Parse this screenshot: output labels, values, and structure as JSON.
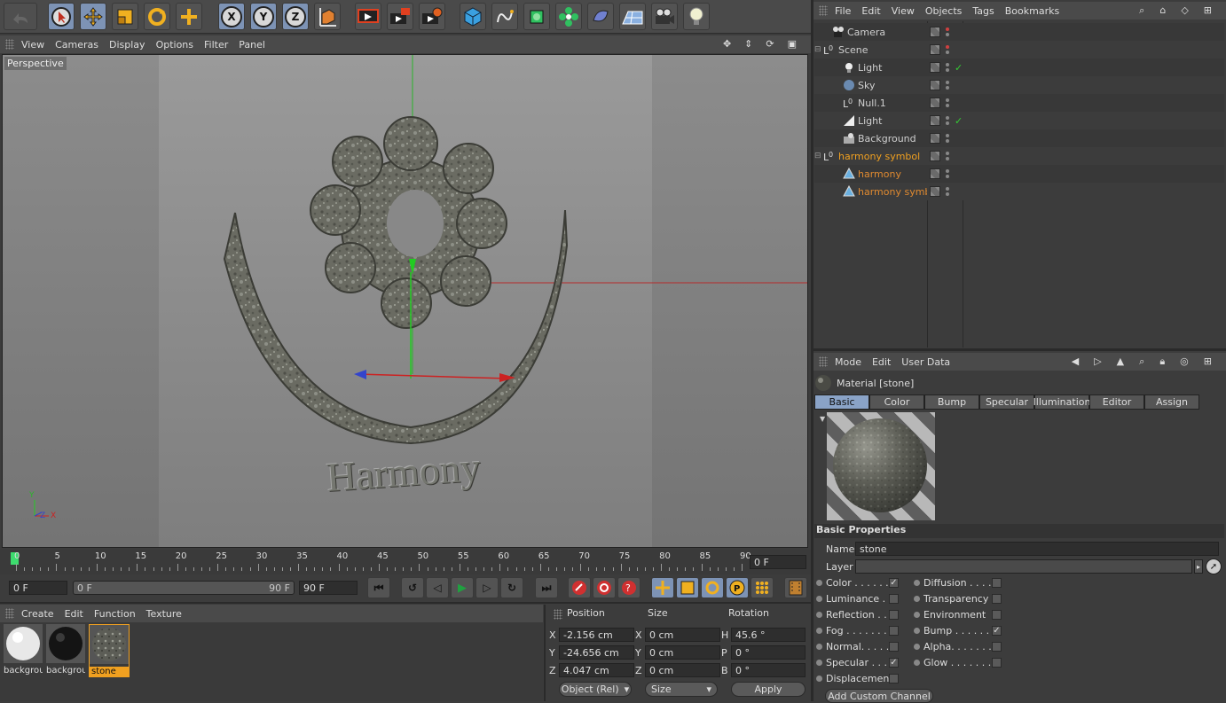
{
  "viewport_menu": [
    "View",
    "Cameras",
    "Display",
    "Options",
    "Filter",
    "Panel"
  ],
  "viewport_label": "Perspective",
  "viewport_text": "Harmony",
  "axis_labels": {
    "y": "Y",
    "z": "Z",
    "x": "X"
  },
  "toolbar": {
    "axis_x": "X",
    "axis_y": "Y",
    "axis_z": "Z"
  },
  "objects_menu": [
    "File",
    "Edit",
    "View",
    "Objects",
    "Tags",
    "Bookmarks"
  ],
  "objects": [
    {
      "name": "Camera",
      "indent": 1,
      "icon": "camera-icon",
      "color": "#cfcfcf"
    },
    {
      "name": "Scene",
      "indent": 0,
      "icon": "null-icon",
      "color": "#cfcfcf"
    },
    {
      "name": "Light",
      "indent": 2,
      "icon": "light-icon",
      "color": "#cfcfcf"
    },
    {
      "name": "Sky",
      "indent": 2,
      "icon": "sky-icon",
      "color": "#cfcfcf"
    },
    {
      "name": "Null.1",
      "indent": 2,
      "icon": "null-icon",
      "color": "#cfcfcf"
    },
    {
      "name": "Light",
      "indent": 2,
      "icon": "spotlight-icon",
      "color": "#cfcfcf"
    },
    {
      "name": "Background",
      "indent": 2,
      "icon": "background-icon",
      "color": "#cfcfcf"
    },
    {
      "name": "harmony symbol",
      "indent": 0,
      "icon": "null-icon",
      "color": "#f0a020"
    },
    {
      "name": "harmony",
      "indent": 2,
      "icon": "polygon-icon",
      "color": "#e08a30"
    },
    {
      "name": "harmony symbol",
      "indent": 2,
      "icon": "polygon-icon",
      "color": "#e08a30"
    }
  ],
  "attr_menu": [
    "Mode",
    "Edit",
    "User Data"
  ],
  "material_title": "Material [stone]",
  "attr_tabs": [
    "Basic",
    "Color",
    "Bump",
    "Specular",
    "Illumination",
    "Editor",
    "Assign"
  ],
  "active_tab": "Basic",
  "basic_props_title": "Basic Properties",
  "name_label": "Name",
  "name_value": "stone",
  "layer_label": "Layer",
  "channels_left": [
    {
      "label": "Color . . . . . .",
      "checked": true
    },
    {
      "label": "Luminance . .",
      "checked": false
    },
    {
      "label": "Reflection . .",
      "checked": false
    },
    {
      "label": "Fog . . . . . . .",
      "checked": false
    },
    {
      "label": "Normal. . . . .",
      "checked": false
    },
    {
      "label": "Specular . . .",
      "checked": true
    },
    {
      "label": "Displacement",
      "checked": false
    }
  ],
  "channels_right": [
    {
      "label": "Diffusion . . . .",
      "checked": false
    },
    {
      "label": "Transparency",
      "checked": false
    },
    {
      "label": "Environment",
      "checked": false
    },
    {
      "label": "Bump . . . . . . .",
      "checked": true
    },
    {
      "label": "Alpha. . . . . . .",
      "checked": false
    },
    {
      "label": "Glow . . . . . . .",
      "checked": false
    }
  ],
  "add_channel_label": "Add Custom Channel",
  "timeline_ticks": [
    "0",
    "5",
    "10",
    "15",
    "20",
    "25",
    "30",
    "35",
    "40",
    "45",
    "50",
    "55",
    "60",
    "65",
    "70",
    "75",
    "80",
    "85",
    "90"
  ],
  "current_frame": "0 F",
  "transport": {
    "start": "0 F",
    "range_start": "0 F",
    "range_end": "90 F",
    "end": "90 F"
  },
  "material_menu": [
    "Create",
    "Edit",
    "Function",
    "Texture"
  ],
  "materials": [
    {
      "name": "backgrou",
      "kind": "white"
    },
    {
      "name": "backgrou",
      "kind": "black"
    },
    {
      "name": "stone",
      "kind": "stone",
      "selected": true
    }
  ],
  "coords": {
    "headers": [
      "Position",
      "Size",
      "Rotation"
    ],
    "rows": [
      {
        "axis": "X",
        "pos": "-2.156 cm",
        "saxis": "X",
        "size": "0 cm",
        "raxis": "H",
        "rot": "45.6 °"
      },
      {
        "axis": "Y",
        "pos": "-24.656 cm",
        "saxis": "Y",
        "size": "0 cm",
        "raxis": "P",
        "rot": "0 °"
      },
      {
        "axis": "Z",
        "pos": "4.047 cm",
        "saxis": "Z",
        "size": "0 cm",
        "raxis": "B",
        "rot": "0 °"
      }
    ],
    "mode": "Object (Rel)",
    "size_mode": "Size",
    "apply": "Apply"
  },
  "colors": {
    "accent": "#8aa3c7",
    "orange": "#f0a020",
    "panel": "#3c3c3c",
    "toolbar": "#4a4a4a"
  }
}
